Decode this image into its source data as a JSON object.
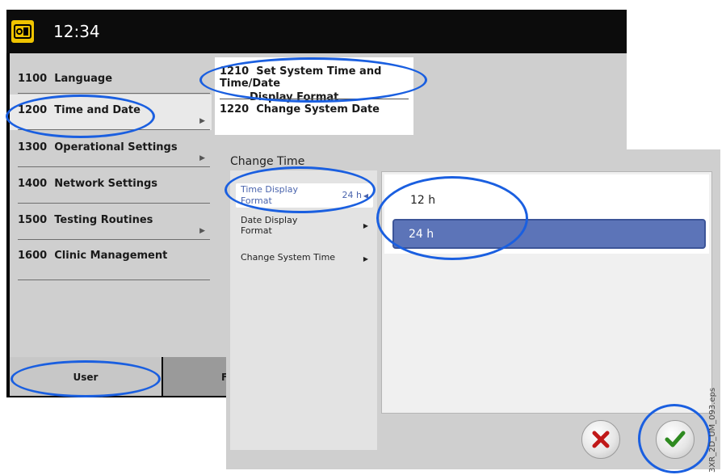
{
  "topbar": {
    "time": "12:34"
  },
  "menu": {
    "items": [
      {
        "code": "1100",
        "label": "Language"
      },
      {
        "code": "1200",
        "label": "Time and Date"
      },
      {
        "code": "1300",
        "label": "Operational Settings"
      },
      {
        "code": "1400",
        "label": "Network Settings"
      },
      {
        "code": "1500",
        "label": "Testing Routines"
      },
      {
        "code": "1600",
        "label": "Clinic Management"
      }
    ]
  },
  "submenu": {
    "items": [
      {
        "code": "1210",
        "line1": "Set System Time and Time/Date",
        "line2": "Display Format"
      },
      {
        "code": "1220",
        "line1": "Change System Date"
      }
    ]
  },
  "footer": {
    "user_tab": "User",
    "second_tab": "F"
  },
  "dialog": {
    "title": "Change Time",
    "items": [
      {
        "line1": "Time Display",
        "line2": "Format",
        "value": "24 h"
      },
      {
        "line1": "Date Display",
        "line2": "Format"
      },
      {
        "line1": "Change System Time"
      }
    ],
    "options": [
      "12 h",
      "24 h"
    ],
    "selected_option": "24 h"
  },
  "figure_code": "3XR_2D_UM_093.eps",
  "colors": {
    "annotation": "#1a5fe0",
    "selection": "#5c74b8",
    "logo": "#f0c400"
  }
}
